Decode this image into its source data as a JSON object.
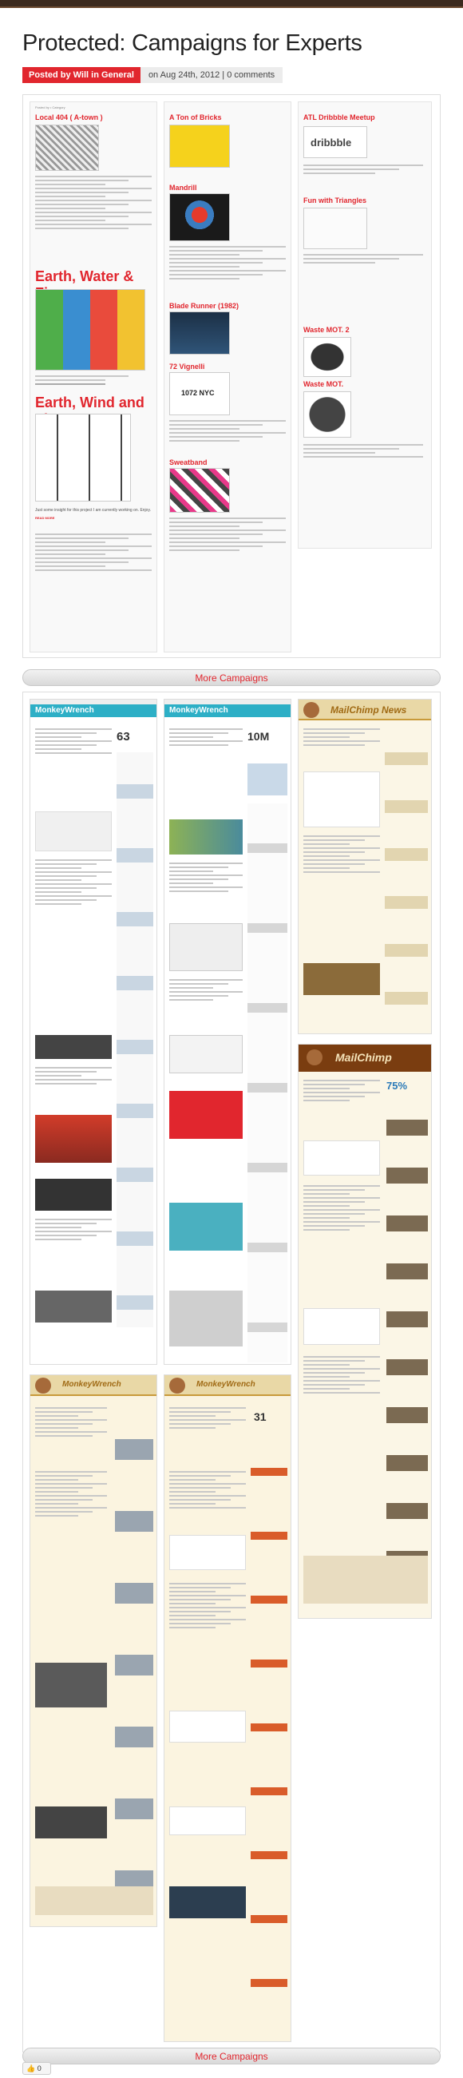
{
  "post": {
    "title": "Protected: Campaigns for Experts",
    "posted_by": "Posted by Will in General",
    "date": "on Aug 24th, 2012 | 0 comments"
  },
  "campaigns_top": {
    "col1": {
      "heading1": "Local 404 ( A-town )",
      "heading2": "Earth, Water & Fire",
      "heading3": "Earth, Wind and Fire",
      "caption": "Just some insight for this project I am currently working on. Enjoy.",
      "read_more": "READ MORE"
    },
    "col2": {
      "heading1": "A Ton of Bricks",
      "heading2": "Mandrill",
      "heading3": "Blade Runner (1982)",
      "heading4": "72 Vignelli",
      "heading5": "Sweatband",
      "poster_text": "1072 NYC"
    },
    "col3": {
      "heading1": "ATL Dribbble Meetup",
      "heading2": "Fun with Triangles",
      "heading3": "Waste MOT. 2",
      "heading4": "Waste MOT.",
      "logo": "dribbble"
    }
  },
  "more_campaigns_1": "More Campaigns",
  "more_campaigns_2": "More Campaigns",
  "newsletters": {
    "mw1_title": "MonkeyWrench",
    "mw1_stat": "63",
    "mw2_title": "MonkeyWrench",
    "mw2_stat": "10M",
    "mc_news_title": "MailChimp News",
    "mc2_title": "MailChimp",
    "mc2_stat": "75%",
    "mw3_title": "MonkeyWrench",
    "mw4_title": "MonkeyWrench",
    "mw4_stat": "31"
  },
  "like_count": "0",
  "colors": {
    "accent_red": "#e1262e",
    "monkeywrench_teal": "#2dafc6",
    "mailchimp_brown": "#7a3d10"
  }
}
